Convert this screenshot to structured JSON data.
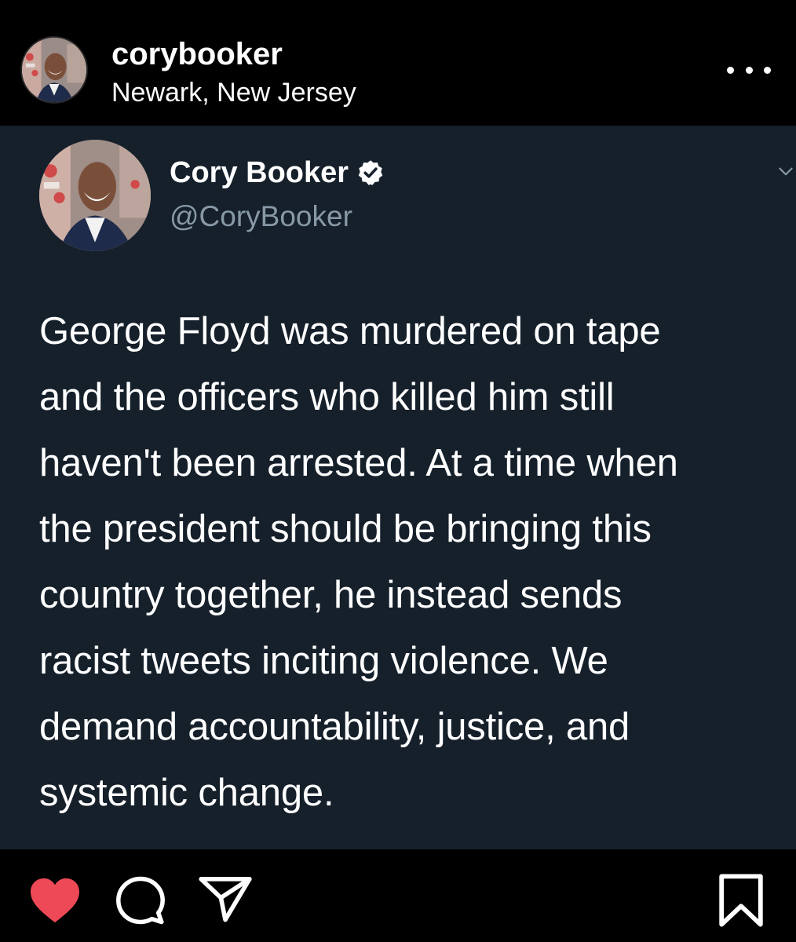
{
  "post": {
    "username": "corybooker",
    "location": "Newark, New Jersey",
    "more_icon": "more-horizontal-icon"
  },
  "tweet": {
    "display_name": "Cory Booker",
    "handle": "@CoryBooker",
    "verified": true,
    "text": "George Floyd was murdered on tape\nand the officers who killed him still\nhaven't been arrested. At a time when\nthe president should be bringing this\ncountry together, he instead sends\nracist tweets inciting violence. We\ndemand accountability, justice, and\nsystemic change."
  },
  "actions": {
    "liked": true,
    "icons": [
      "heart-icon",
      "comment-icon",
      "share-icon",
      "bookmark-icon"
    ]
  },
  "colors": {
    "background": "#000000",
    "tweet_background": "#15202b",
    "handle_text": "#8899a6",
    "like_red": "#ed4956",
    "text": "#ffffff"
  }
}
